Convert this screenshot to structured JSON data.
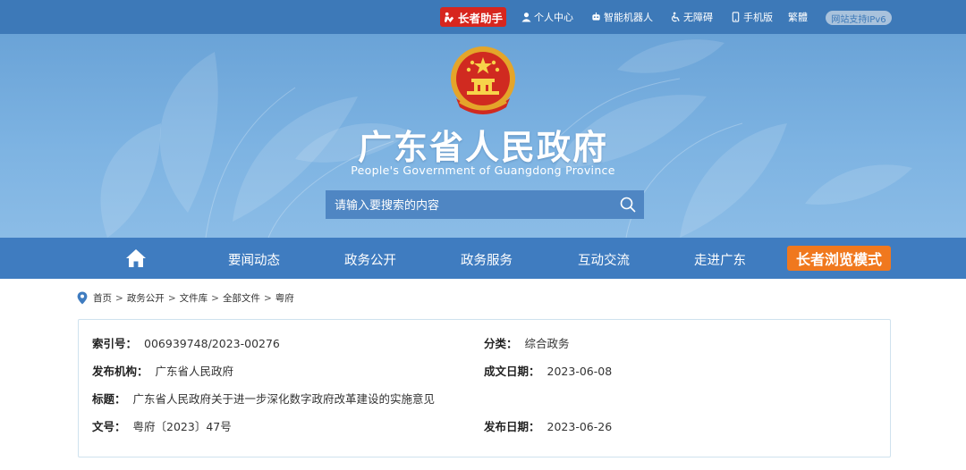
{
  "topbar": {
    "elder_helper": "长者助手",
    "links": [
      {
        "label": "个人中心",
        "icon": "user-icon"
      },
      {
        "label": "智能机器人",
        "icon": "robot-icon"
      },
      {
        "label": "无障碍",
        "icon": "accessibility-icon"
      },
      {
        "label": "手机版",
        "icon": "mobile-icon"
      },
      {
        "label": "繁體",
        "icon": ""
      }
    ],
    "ipv6_badge": "网站支持IPv6"
  },
  "banner": {
    "title": "广东省人民政府",
    "subtitle": "People's Government of Guangdong Province",
    "search_placeholder": "请输入要搜索的内容"
  },
  "nav": {
    "items": [
      "要闻动态",
      "政务公开",
      "政务服务",
      "互动交流",
      "走进广东"
    ],
    "elder_mode": "长者浏览模式"
  },
  "breadcrumb": [
    "首页",
    "政务公开",
    "文件库",
    "全部文件",
    "粤府"
  ],
  "document": {
    "index_label": "索引号：",
    "index_value": "006939748/2023-00276",
    "category_label": "分类：",
    "category_value": "综合政务",
    "publisher_label": "发布机构：",
    "publisher_value": "广东省人民政府",
    "created_label": "成文日期：",
    "created_value": "2023-06-08",
    "title_label": "标题：",
    "title_value": "广东省人民政府关于进一步深化数字政府改革建设的实施意见",
    "number_label": "文号：",
    "number_value": "粤府〔2023〕47号",
    "published_label": "发布日期：",
    "published_value": "2023-06-26"
  },
  "colors": {
    "topbar": "#3d79b8",
    "nav": "#3f7cc0",
    "banner": "#7db3e2",
    "elder_red": "#d7261e",
    "elder_mode_orange": "#f0781e",
    "card_border": "#cfe2ee"
  }
}
